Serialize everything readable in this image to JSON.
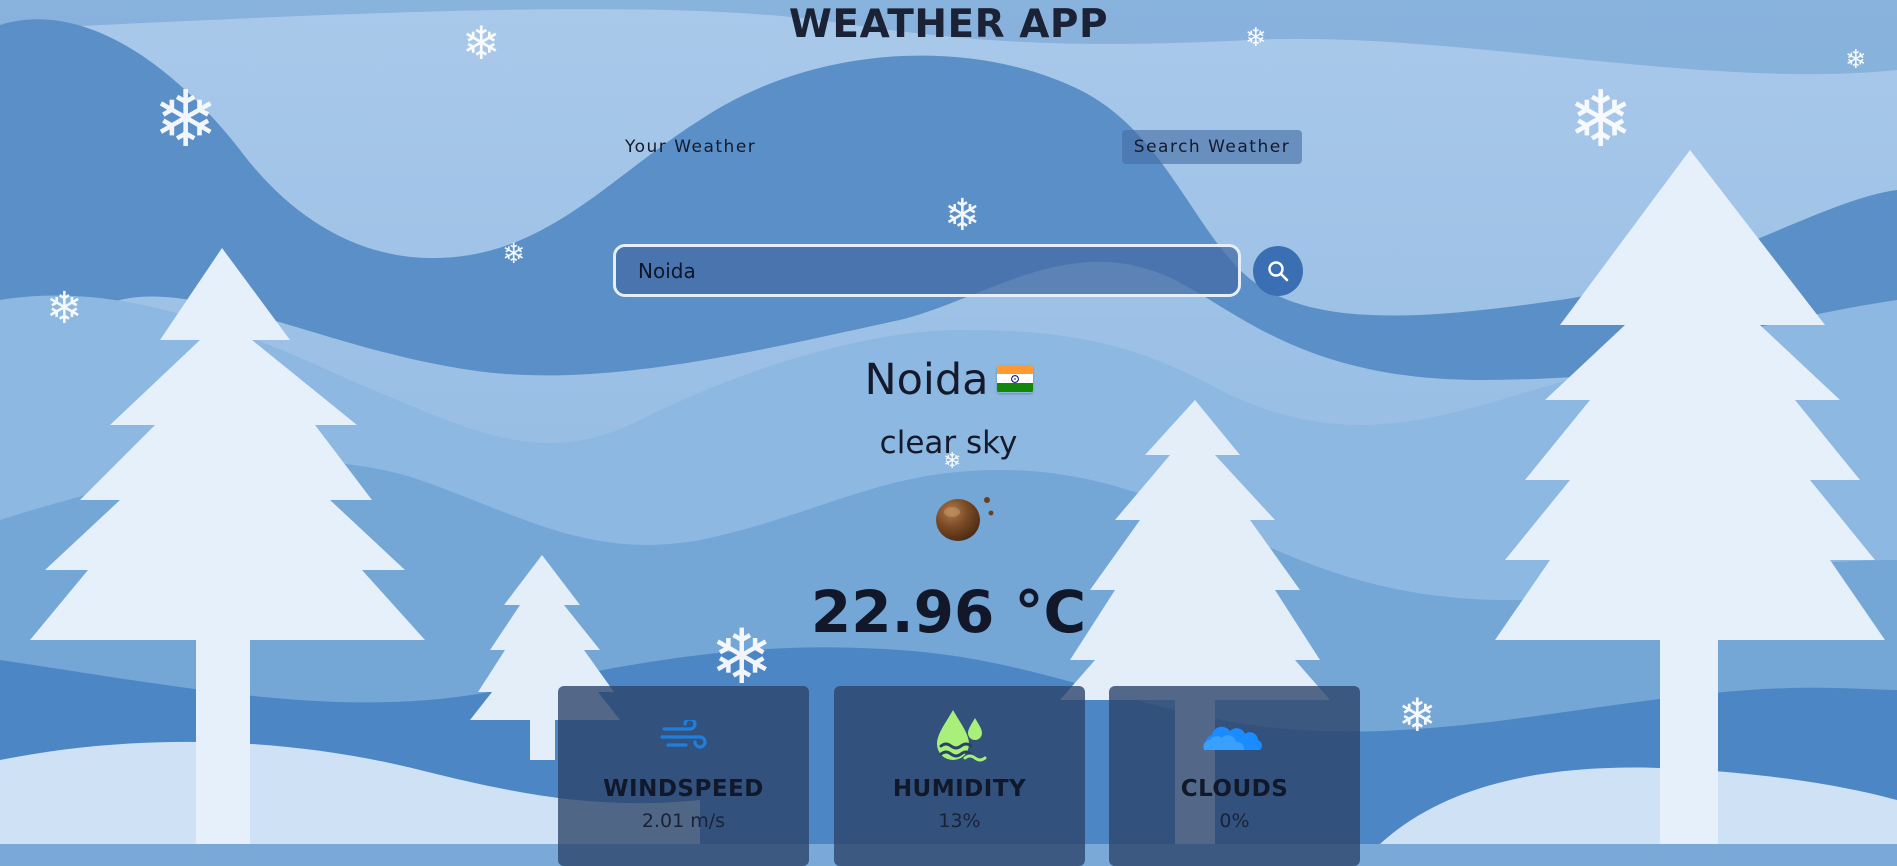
{
  "app": {
    "title": "WEATHER APP"
  },
  "tabs": {
    "your_weather": "Your Weather",
    "search_weather": "Search Weather"
  },
  "search": {
    "value": "Noida",
    "icon": "search-icon"
  },
  "current": {
    "city": "Noida",
    "country_flag": "india-flag-icon",
    "description": "clear sky",
    "weather_icon": "clear-sky-icon",
    "temperature": "22.96 °C"
  },
  "stats": {
    "windspeed": {
      "label": "WINDSPEED",
      "value": "2.01 m/s",
      "icon": "wind-icon"
    },
    "humidity": {
      "label": "HUMIDITY",
      "value": "13%",
      "icon": "humidity-icon"
    },
    "clouds": {
      "label": "CLOUDS",
      "value": "0%",
      "icon": "cloud-icon"
    }
  },
  "colors": {
    "accent": "#3a70b3",
    "card_bg": "#2a4268",
    "text_dark": "#141a2c",
    "wind_icon": "#1e7fe0",
    "humidity_icon": "#a9f07a",
    "cloud_icon": "#1a8cff"
  }
}
